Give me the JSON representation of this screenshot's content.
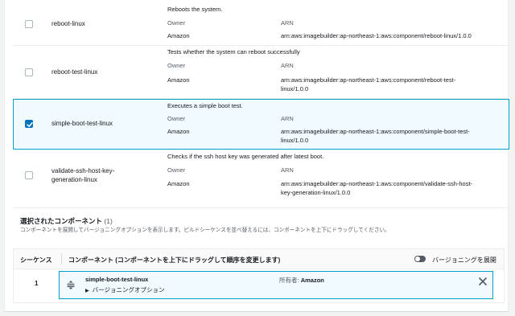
{
  "components": [
    {
      "name": "reboot-linux",
      "checked": false,
      "description": "Reboots the system.",
      "owner_label": "Owner",
      "owner_value": "Amazon",
      "arn_label": "ARN",
      "arn_value": "arn:aws:imagebuilder:ap-northeast-1:aws:component/reboot-linux/1.0.0"
    },
    {
      "name": "reboot-test-linux",
      "checked": false,
      "description": "Tests whether the system can reboot successfully",
      "owner_label": "Owner",
      "owner_value": "Amazon",
      "arn_label": "ARN",
      "arn_value_line1": "arn:aws:imagebuilder:ap-northeast-1:aws:component/reboot-test-",
      "arn_value_line2": "linux/1.0.0"
    },
    {
      "name": "simple-boot-test-linux",
      "checked": true,
      "description": "Executes a simple boot test.",
      "owner_label": "Owner",
      "owner_value": "Amazon",
      "arn_label": "ARN",
      "arn_value_line1": "arn:aws:imagebuilder:ap-northeast-1:aws:component/simple-boot-test-",
      "arn_value_line2": "linux/1.0.0"
    },
    {
      "name_line1": "validate-ssh-host-key-",
      "name_line2": "generation-linux",
      "checked": false,
      "description": "Checks if the ssh host key was generated after latest boot.",
      "owner_label": "Owner",
      "owner_value": "Amazon",
      "arn_label": "ARN",
      "arn_value_line1": "arn:aws:imagebuilder:ap-northeast-1:aws:component/validate-ssh-host-",
      "arn_value_line2": "key-generation-linux/1.0.0"
    }
  ],
  "selected_section": {
    "title": "選択されたコンポーネント",
    "count": "(1)",
    "description": "コンポーネントを展開してバージョニングオプションを表示します。ビルドシーケンスを並べ替えるには、コンポーネントを上下にドラッグしてください。"
  },
  "sequence_table": {
    "col_sequence": "シーケンス",
    "col_component": "コンポーネント (コンポーネントを上下にドラッグして順序を変更します)",
    "toggle_label": "バージョニングを展開",
    "rows": [
      {
        "seq": "1",
        "name": "simple-boot-test-linux",
        "owner_label": "所有者:",
        "owner_value": "Amazon",
        "expander_label": "バージョニングオプション"
      }
    ]
  },
  "colors": {
    "accent": "#0073bb",
    "selected_border": "#00a1c9",
    "selected_bg": "#f1faff"
  }
}
